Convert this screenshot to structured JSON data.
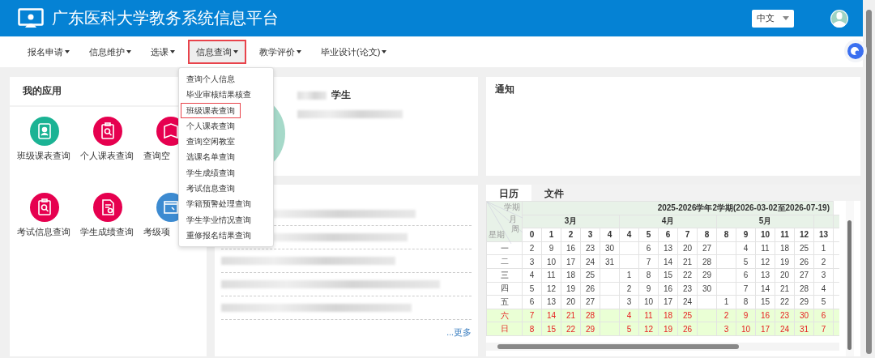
{
  "header": {
    "title": "广东医科大学教务系统信息平台",
    "language": "中文"
  },
  "nav": [
    {
      "label": "报名申请",
      "selected": false
    },
    {
      "label": "信息维护",
      "selected": false
    },
    {
      "label": "选课",
      "selected": false
    },
    {
      "label": "信息查询",
      "selected": true
    },
    {
      "label": "教学评价",
      "selected": false
    },
    {
      "label": "毕业设计(论文)",
      "selected": false
    }
  ],
  "dropdown": [
    {
      "label": "查询个人信息",
      "selected": false
    },
    {
      "label": "毕业审核结果核查",
      "selected": false
    },
    {
      "label": "班级课表查询",
      "selected": true
    },
    {
      "label": "个人课表查询",
      "selected": false
    },
    {
      "label": "查询空闲教室",
      "selected": false
    },
    {
      "label": "选课名单查询",
      "selected": false
    },
    {
      "label": "学生成绩查询",
      "selected": false
    },
    {
      "label": "考试信息查询",
      "selected": false
    },
    {
      "label": "学籍预警处理查询",
      "selected": false
    },
    {
      "label": "学生学业情况查询",
      "selected": false
    },
    {
      "label": "重修报名结果查询",
      "selected": false
    }
  ],
  "my_apps": {
    "title": "我的应用",
    "items": [
      {
        "label": "班级课表查询",
        "kind": "contacts",
        "color": "#1bb394"
      },
      {
        "label": "个人课表查询",
        "kind": "clipboard",
        "color": "#e6004f"
      },
      {
        "label": "查询空",
        "kind": "book",
        "color": "#e6004f"
      },
      {
        "label": "考试信息查询",
        "kind": "clipboard",
        "color": "#e6004f"
      },
      {
        "label": "学生成绩查询",
        "kind": "document",
        "color": "#e6004f"
      },
      {
        "label": "考级项",
        "kind": "window",
        "color": "#3d8bd1"
      }
    ]
  },
  "profile": {
    "role": "学生"
  },
  "notice": {
    "title": "通知"
  },
  "news": {
    "more": "...更多"
  },
  "calendar": {
    "tabs": [
      {
        "label": "日历",
        "selected": true
      },
      {
        "label": "文件",
        "selected": false
      }
    ],
    "corner": {
      "term": "学期",
      "month": "月",
      "week": "周",
      "weekday": "星期"
    },
    "term": "2025-2026学年2学期(2026-03-02至2026-07-19)",
    "months": [
      "3月",
      "4月",
      "5月"
    ],
    "weeks": [
      "0",
      "1",
      "2",
      "3",
      "4",
      "4",
      "5",
      "6",
      "7",
      "8",
      "8",
      "9",
      "10",
      "11",
      "12",
      "13"
    ],
    "rows": [
      {
        "day": "一",
        "weekend": false,
        "cells": [
          "2",
          "9",
          "16",
          "23",
          "30",
          null,
          "6",
          "13",
          "20",
          "27",
          null,
          "4",
          "11",
          "18",
          "25",
          "1"
        ]
      },
      {
        "day": "二",
        "weekend": false,
        "cells": [
          "3",
          "10",
          "17",
          "24",
          "31",
          null,
          "7",
          "14",
          "21",
          "28",
          null,
          "5",
          "12",
          "19",
          "26",
          "2"
        ]
      },
      {
        "day": "三",
        "weekend": false,
        "cells": [
          "4",
          "11",
          "18",
          "25",
          null,
          "1",
          "8",
          "15",
          "22",
          "29",
          null,
          "6",
          "13",
          "20",
          "27",
          "3"
        ]
      },
      {
        "day": "四",
        "weekend": false,
        "cells": [
          "5",
          "12",
          "19",
          "26",
          null,
          "2",
          "9",
          "16",
          "23",
          "30",
          null,
          "7",
          "14",
          "21",
          "28",
          "4"
        ]
      },
      {
        "day": "五",
        "weekend": false,
        "cells": [
          "6",
          "13",
          "20",
          "27",
          null,
          "3",
          "10",
          "17",
          "24",
          null,
          "1",
          "8",
          "15",
          "22",
          "29",
          "5"
        ]
      },
      {
        "day": "六",
        "weekend": true,
        "cells": [
          "7",
          "14",
          "21",
          "28",
          null,
          "4",
          "11",
          "18",
          "25",
          null,
          "2",
          "9",
          "16",
          "23",
          "30",
          "6"
        ]
      },
      {
        "day": "日",
        "weekend": true,
        "cells": [
          "8",
          "15",
          "22",
          "29",
          null,
          "5",
          "12",
          "19",
          "26",
          null,
          "3",
          "10",
          "17",
          "24",
          "31",
          "7"
        ]
      }
    ]
  }
}
